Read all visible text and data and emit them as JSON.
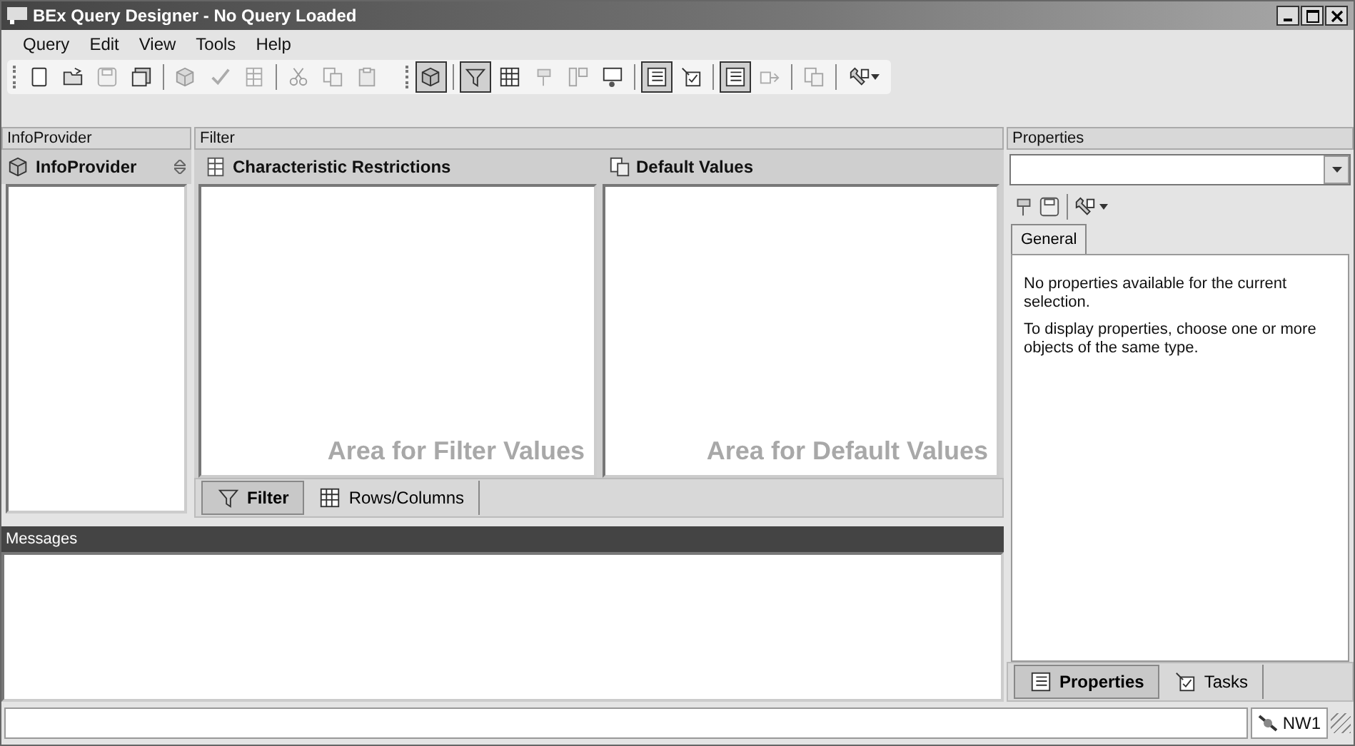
{
  "window": {
    "title": "BEx Query Designer - No Query Loaded"
  },
  "menu": [
    "Query",
    "Edit",
    "View",
    "Tools",
    "Help"
  ],
  "toolbar": [
    {
      "kind": "button",
      "disabled": false,
      "pressed": false
    },
    {
      "kind": "button",
      "disabled": false,
      "pressed": false
    },
    {
      "kind": "button",
      "disabled": true,
      "pressed": false
    },
    {
      "kind": "button",
      "disabled": false,
      "pressed": false
    },
    {
      "kind": "separator"
    },
    {
      "kind": "button",
      "disabled": true,
      "pressed": false
    },
    {
      "kind": "button",
      "disabled": true,
      "pressed": false
    },
    {
      "kind": "button",
      "disabled": true,
      "pressed": false
    },
    {
      "kind": "separator"
    },
    {
      "kind": "button",
      "disabled": true,
      "pressed": false
    },
    {
      "kind": "button",
      "disabled": true,
      "pressed": false
    },
    {
      "kind": "button",
      "disabled": true,
      "pressed": false
    },
    {
      "kind": "gap"
    },
    {
      "kind": "button",
      "disabled": false,
      "pressed": true
    },
    {
      "kind": "separator"
    },
    {
      "kind": "button",
      "disabled": false,
      "pressed": true
    },
    {
      "kind": "button",
      "disabled": false,
      "pressed": false
    },
    {
      "kind": "button",
      "disabled": true,
      "pressed": false
    },
    {
      "kind": "button",
      "disabled": true,
      "pressed": false
    },
    {
      "kind": "button",
      "disabled": false,
      "pressed": false
    },
    {
      "kind": "separator"
    },
    {
      "kind": "button",
      "disabled": false,
      "pressed": true
    },
    {
      "kind": "button",
      "disabled": false,
      "pressed": false
    },
    {
      "kind": "separator"
    },
    {
      "kind": "button",
      "disabled": false,
      "pressed": true
    },
    {
      "kind": "button",
      "disabled": true,
      "pressed": false
    },
    {
      "kind": "separator"
    },
    {
      "kind": "button",
      "disabled": true,
      "pressed": false
    },
    {
      "kind": "separator"
    },
    {
      "kind": "dropdown",
      "disabled": false,
      "pressed": false
    }
  ],
  "infoprovider": {
    "header": "InfoProvider",
    "title": "InfoProvider"
  },
  "filter": {
    "header": "Filter",
    "panes": [
      {
        "title": "Characteristic Restrictions",
        "hint": "Area for Filter Values"
      },
      {
        "title": "Default Values",
        "hint": "Area for Default Values"
      }
    ],
    "tabs": [
      {
        "label": "Filter",
        "selected": true
      },
      {
        "label": "Rows/Columns",
        "selected": false
      }
    ]
  },
  "messages": {
    "header": "Messages"
  },
  "properties": {
    "header": "Properties",
    "general_tab": "General",
    "notes": [
      "No properties available for the current selection.",
      "To display properties, choose one or more objects of the same type."
    ],
    "tabs": [
      {
        "label": "Properties",
        "selected": true
      },
      {
        "label": "Tasks",
        "selected": false
      }
    ]
  },
  "status_bar": {
    "system": "NW1"
  }
}
